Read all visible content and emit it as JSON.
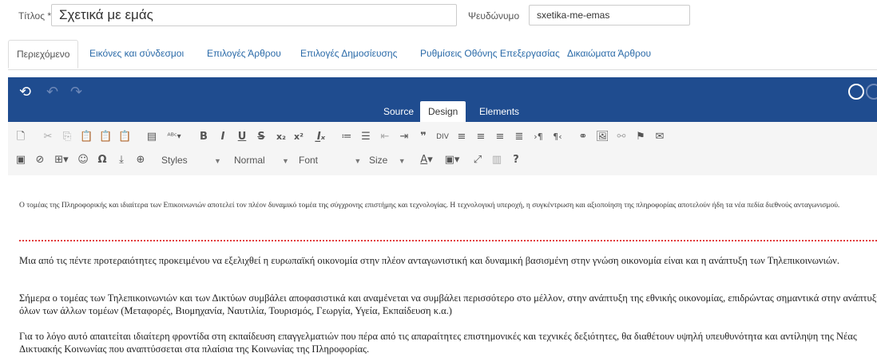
{
  "form": {
    "title_label": "Τίτλος *",
    "title_value": "Σχετικά με εμάς",
    "alias_label": "Ψευδώνυμο",
    "alias_value": "sxetika-me-emas"
  },
  "tabs": [
    {
      "label": "Περιεχόμενο",
      "active": true
    },
    {
      "label": "Εικόνες και σύνδεσμοι",
      "active": false
    },
    {
      "label": "Επιλογές Άρθρου",
      "active": false
    },
    {
      "label": "Επιλογές Δημοσίευσης",
      "active": false
    },
    {
      "label": "Ρυθμίσεις Οθόνης Επεξεργασίας",
      "active": false
    },
    {
      "label": "Δικαιώματα Άρθρου",
      "active": false
    }
  ],
  "editor": {
    "modes": [
      "Source",
      "Design",
      "Elements"
    ],
    "active_mode": "Design",
    "colors": {
      "bar": "#1f4c8f"
    }
  },
  "toolbar": {
    "styles": "Styles",
    "format": "Normal",
    "font": "Font",
    "size": "Size",
    "help": "?"
  },
  "content": {
    "intro": "Ο τομέας της Πληροφορικής και ιδιαίτερα των Επικοινωνιών αποτελεί τον πλέον δυναμικό τομέα της σύγχρονης επιστήμης και τεχνολογίας. Η τεχνολογική υπεροχή, η συγκέντρωση και αξιοποίηση της πληροφορίας αποτελούν ήδη τα νέα πεδία διεθνούς ανταγωνισμού.",
    "paragraphs": [
      "Μια από τις πέντε προτεραιότητες προκειμένου να εξελιχθεί η ευρωπαϊκή οικονομία στην πλέον ανταγωνιστική και δυναμική βασισμένη στην γνώση οικονομία είναι και η ανάπτυξη των Τηλεπικοινωνιών.",
      "Σήμερα ο τομέας των Τηλεπικοινωνιών και των Δικτύων συμβάλει αποφασιστικά και αναμένεται να συμβάλει περισσότερο στο μέλλον, στην ανάπτυξη της εθνικής οικονομίας, επιδρώντας σημαντικά στην ανάπτυξη όλων των άλλων τομέων (Μεταφορές, Βιομηχανία, Ναυτιλία, Τουρισμός, Γεωργία, Υγεία, Εκπαίδευση κ.α.)",
      "Για το λόγο αυτό απαιτείται ιδιαίτερη φροντίδα στη εκπαίδευση επαγγελματιών που πέρα από τις απαραίτητες επιστημονικές και τεχνικές δεξιότητες, θα διαθέτουν υψηλή υπευθυνότητα και αντίληψη της Νέας Δικτυακής Κοινωνίας που αναπτύσσεται στα πλαίσια της Κοινωνίας της Πληροφορίας."
    ]
  }
}
